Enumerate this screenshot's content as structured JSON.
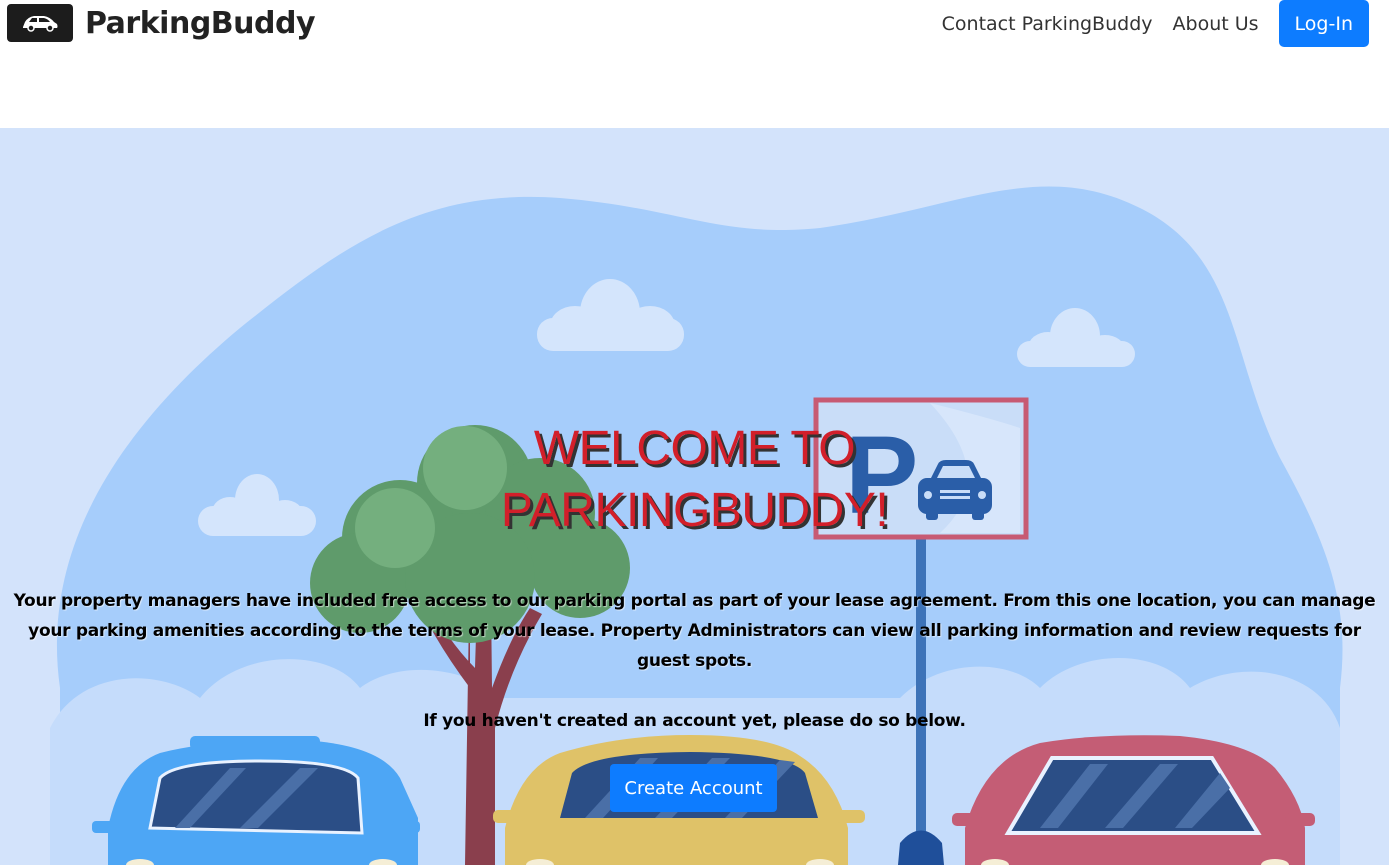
{
  "brand": {
    "name": "ParkingBuddy",
    "logo_icon": "car-icon"
  },
  "nav": {
    "links": [
      {
        "label": "Contact ParkingBuddy"
      },
      {
        "label": "About Us"
      }
    ],
    "login_label": "Log-In"
  },
  "hero": {
    "title_line1": "WELCOME TO",
    "title_line2": "PARKINGBUDDY!",
    "description": "Your property managers have included free access to our parking portal as part of your lease agreement. From this one location, you can manage your parking amenities according to the terms of your lease. Property Administrators can view all parking information and review requests for guest spots.",
    "prompt": "If you haven't created an account yet, please do so below.",
    "create_account_label": "Create Account"
  },
  "colors": {
    "accent": "#0d7cff",
    "title_red": "#d21f2a",
    "hero_background": "#d3e3fb"
  }
}
